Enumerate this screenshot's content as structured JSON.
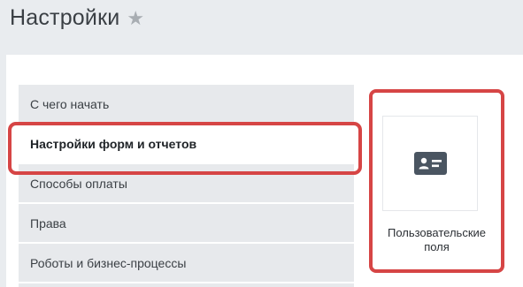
{
  "header": {
    "title": "Настройки",
    "star_icon": "star-icon"
  },
  "menu": {
    "items": [
      {
        "label": "С чего начать",
        "active": false
      },
      {
        "label": "Настройки форм и отчетов",
        "active": true
      },
      {
        "label": "Способы оплаты",
        "active": false
      },
      {
        "label": "Права",
        "active": false
      },
      {
        "label": "Роботы и бизнес-процессы",
        "active": false
      }
    ]
  },
  "tile": {
    "icon": "id-card-icon",
    "label_line1": "Пользовательские",
    "label_line2": "поля"
  },
  "colors": {
    "highlight": "#d64545",
    "background": "#e9ecef",
    "menu_item_bg": "#e7e9ec",
    "icon": "#4a5561"
  }
}
